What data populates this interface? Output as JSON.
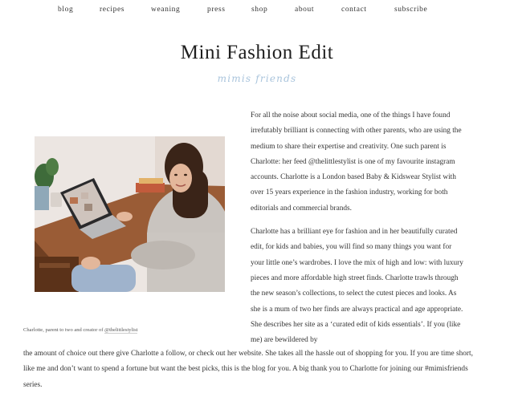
{
  "nav": {
    "items": [
      {
        "label": "blog"
      },
      {
        "label": "recipes"
      },
      {
        "label": "weaning"
      },
      {
        "label": "press"
      },
      {
        "label": "shop"
      },
      {
        "label": "about"
      },
      {
        "label": "contact"
      },
      {
        "label": "subscribe"
      }
    ]
  },
  "article": {
    "title": "Mini Fashion Edit",
    "script_subtitle": "mimis friends",
    "caption_text": "Charlotte, parent to two and creator of ",
    "caption_handle": "@thelittlestylist",
    "paragraph_1": "For all the noise about social media, one of the things I have found irrefutably brilliant is connecting with other parents, who are using the medium to share their expertise and creativity. One such parent is Charlotte: her feed @thelittlestylist is one of my favourite instagram accounts. Charlotte is a London based Baby & Kidswear Stylist with over 15 years experience in the fashion industry, working for both editorials and commercial brands.",
    "paragraph_2a": "Charlotte has a brilliant eye for fashion and in her beautifully curated edit, for kids and babies, you will find so many things you want for your little one’s wardrobes. I love the mix of high and low: with luxury pieces and more affordable high street finds. Charlotte trawls through the new season’s collections, to select the cutest pieces and looks. As she is a mum of two her finds are always practical and age appropriate. She describes her site as a ‘curated edit of kids essentials’. If you (like me) are bewildered by",
    "paragraph_2b": "the amount of choice out there give Charlotte a follow, or check out her website. She takes all the hassle out of shopping for you. If you are time short, like me and don’t want to spend a fortune but want the best picks, this is the blog for you. A big thank you to Charlotte for joining our #mimisfriends series."
  }
}
